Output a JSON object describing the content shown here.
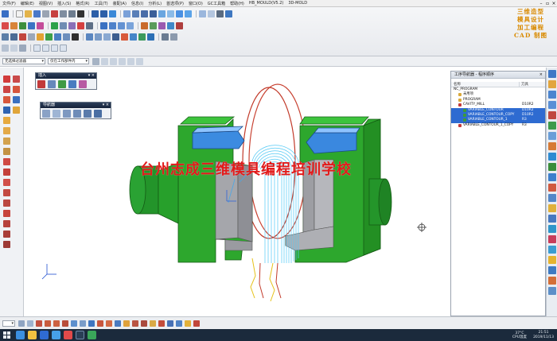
{
  "menubar": {
    "items": [
      "文件(F)",
      "编辑(E)",
      "视图(V)",
      "插入(S)",
      "格式(R)",
      "工具(T)",
      "装配(A)",
      "信息(I)",
      "分析(L)",
      "首选项(P)",
      "窗口(O)",
      "GC工具箱",
      "帮助(H)",
      "HB_MOULD(V5.2)",
      "3D-MOLD"
    ]
  },
  "brand": {
    "line1": "三维造型",
    "line2": "模具设计",
    "line3": "加工编程",
    "line4": "CAD 制图"
  },
  "selection_bar": {
    "filter": "无选择过滤器",
    "scope": "仅在工作部件内"
  },
  "palettes": {
    "insert_title": "插入",
    "operation_title": "导航器"
  },
  "watermark": "台州志成三维模具编程培训学校",
  "navigator": {
    "title": "工序导航器 - 程序顺序",
    "col_name": "名称",
    "col_tool": "刀具",
    "rows": [
      {
        "name": "NC_PROGRAM",
        "tool": "",
        "indent": 0,
        "selected": false,
        "icon": "none"
      },
      {
        "name": "未用项",
        "tool": "",
        "indent": 1,
        "selected": false,
        "icon": "folder"
      },
      {
        "name": "PROGRAM",
        "tool": "",
        "indent": 1,
        "selected": false,
        "icon": "folder"
      },
      {
        "name": "CAVITY_MILL",
        "tool": "D10R2",
        "indent": 1,
        "selected": false,
        "icon": "op-red"
      },
      {
        "name": "VARIABLE_CONTOUR",
        "tool": "D10R2",
        "indent": 2,
        "selected": true,
        "icon": "op-green"
      },
      {
        "name": "VARIABLE_CONTOUR_COPY",
        "tool": "D10R2",
        "indent": 2,
        "selected": true,
        "icon": "op-green"
      },
      {
        "name": "VARIABLE_CONTOUR_1",
        "tool": "R3",
        "indent": 2,
        "selected": true,
        "icon": "op-green"
      },
      {
        "name": "VARIABLE_CONTOUR_1_COPY",
        "tool": "R3",
        "indent": 1,
        "selected": false,
        "icon": "op-red"
      }
    ]
  },
  "taskbar": {
    "temp": "37°C",
    "cpu": "CPU温度",
    "time": "21:51",
    "date": "2019/11/13"
  },
  "icons": {
    "accent": "#2e6bd1",
    "model_green": "#2fae2f",
    "toolpath": "#4fc3f7"
  }
}
